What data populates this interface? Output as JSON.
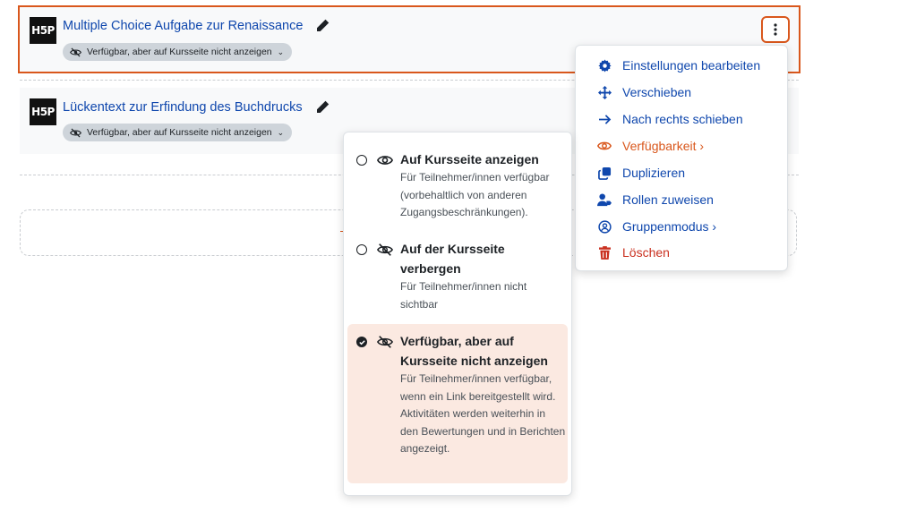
{
  "activities": [
    {
      "icon_text": "H5P",
      "title": "Multiple Choice Aufgabe zur Renaissance",
      "badge": "Verfügbar, aber auf Kursseite nicht anzeigen"
    },
    {
      "icon_text": "H5P",
      "title": "Lückentext zur Erfindung des Buchdrucks",
      "badge": "Verfügbar, aber auf Kursseite nicht anzeigen"
    }
  ],
  "action_menu": {
    "items": [
      {
        "label": "Einstellungen bearbeiten",
        "icon": "gear-icon"
      },
      {
        "label": "Verschieben",
        "icon": "move-icon"
      },
      {
        "label": "Nach rechts schieben",
        "icon": "arrow-right-icon"
      },
      {
        "label": "Verfügbarkeit",
        "icon": "eye-icon",
        "suffix": "›"
      },
      {
        "label": "Duplizieren",
        "icon": "copy-icon"
      },
      {
        "label": "Rollen zuweisen",
        "icon": "user-tag-icon"
      },
      {
        "label": "Gruppenmodus",
        "icon": "group-icon",
        "suffix": "›"
      },
      {
        "label": "Löschen",
        "icon": "trash-icon"
      }
    ]
  },
  "availability_menu": {
    "options": [
      {
        "title": "Auf Kursseite anzeigen",
        "description": "Für Teilnehmer/innen verfügbar (vorbehaltlich von anderen Zugangsbeschränkungen).",
        "icon": "eye-icon",
        "selected": false
      },
      {
        "title": "Auf der Kursseite verbergen",
        "description": "Für Teilnehmer/innen nicht sichtbar",
        "icon": "eye-slash-icon",
        "selected": false
      },
      {
        "title": "Verfügbar, aber auf Kursseite nicht anzeigen",
        "description": "Für Teilnehmer/innen verfügbar, wenn ein Link bereitgestellt wird. Aktivitäten werden weiterhin in den Bewertungen und in Berichten angezeigt.",
        "icon": "eye-slash-icon",
        "selected": true
      }
    ]
  },
  "colors": {
    "link": "#0f47ad",
    "accent": "#d9571c",
    "danger": "#ca3120",
    "selected_bg": "#fbe9e1"
  }
}
